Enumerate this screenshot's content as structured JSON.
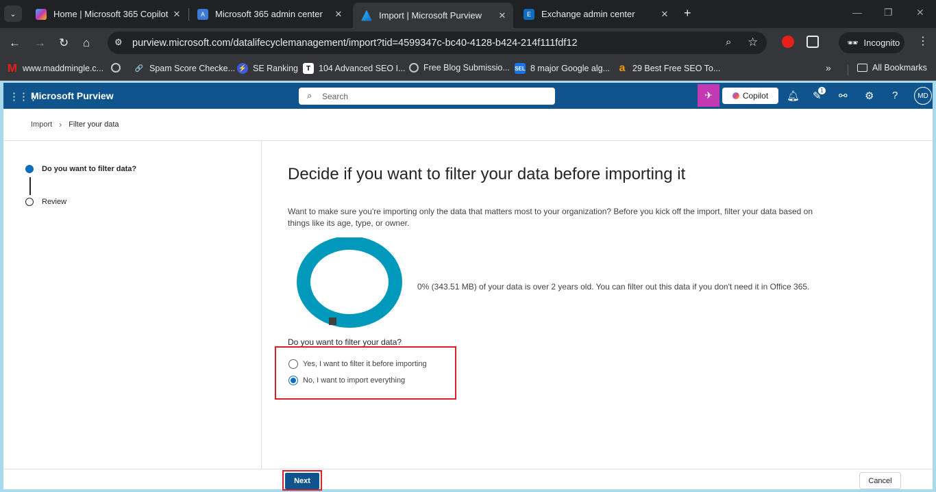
{
  "browser": {
    "tabs": [
      {
        "title": "Home | Microsoft 365 Copilot",
        "favicon": "copilot-icon"
      },
      {
        "title": "Microsoft 365 admin center",
        "favicon": "admin-icon"
      },
      {
        "title": "Import | Microsoft Purview",
        "favicon": "purview-icon",
        "active": true
      },
      {
        "title": "Exchange admin center",
        "favicon": "exchange-icon"
      }
    ],
    "url": "purview.microsoft.com/datalifecyclemanagement/import?tid=4599347c-bc40-4128-b424-214f111fdf12",
    "profile_label": "Incognito",
    "bookmarks": [
      "www.maddmingle.c...",
      "Spam Score Checke...",
      "SE Ranking",
      "104 Advanced SEO I...",
      "Free Blog Submissio...",
      "8 major Google alg...",
      "29 Best Free SEO To..."
    ],
    "all_bookmarks_label": "All Bookmarks"
  },
  "app": {
    "name": "Microsoft Purview",
    "search_placeholder": "Search",
    "copilot_label": "Copilot",
    "notification_badge": "1",
    "avatar_initials": "MD",
    "brand_color": "#0f548c"
  },
  "breadcrumb": {
    "items": [
      "Import",
      "Filter your data"
    ]
  },
  "steps": [
    {
      "label": "Do you want to filter data?",
      "state": "current"
    },
    {
      "label": "Review",
      "state": "pending"
    }
  ],
  "main": {
    "heading": "Decide if you want to filter your data before importing it",
    "description": "Want to make sure you're importing only the data that matters most to your organization? Before you kick off the import, filter your data based on things like its age, type, or owner.",
    "stat_text": "0% (343.51 MB) of your data is over 2 years old. You can filter out this data if you don't need it in Office 365.",
    "question": "Do you want to filter your data?",
    "options": [
      {
        "label": "Yes, I want to filter it before importing",
        "selected": false
      },
      {
        "label": "No, I want to import everything",
        "selected": true
      }
    ],
    "donut_color": "#0099bc"
  },
  "footer": {
    "next_label": "Next",
    "cancel_label": "Cancel"
  }
}
